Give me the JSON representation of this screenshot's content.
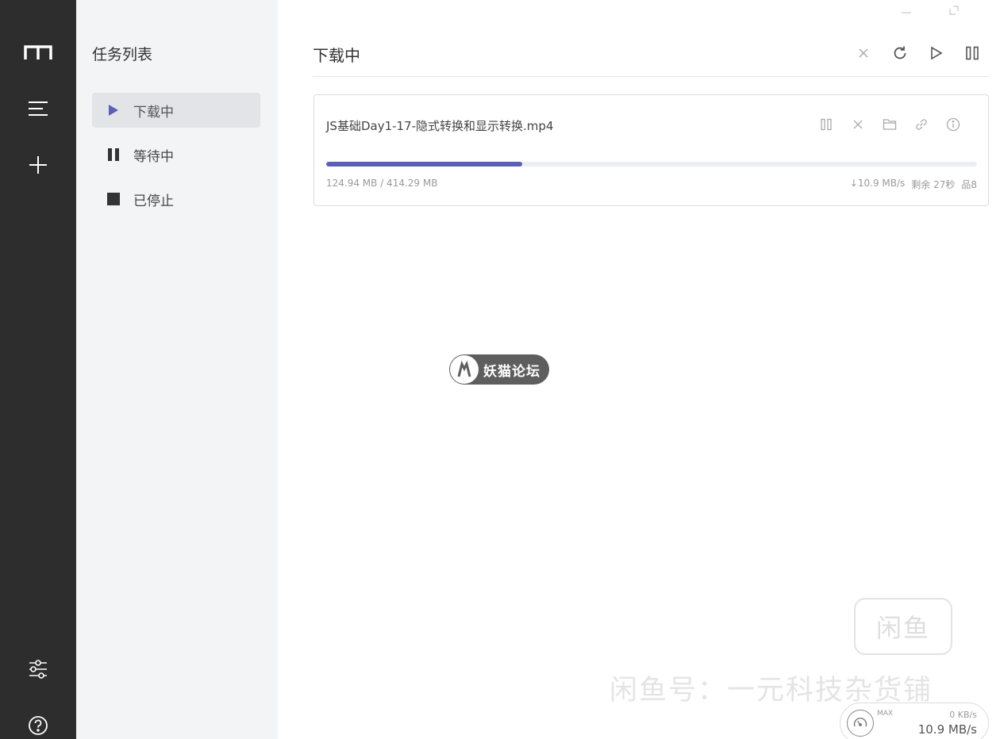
{
  "rail": {
    "logo_icon": "app-logo-icon",
    "items": [
      {
        "name": "task-list-icon"
      },
      {
        "name": "add-icon"
      }
    ],
    "bottom": [
      {
        "name": "settings-sliders-icon"
      },
      {
        "name": "help-icon"
      }
    ]
  },
  "tasklist": {
    "title": "任务列表",
    "items": [
      {
        "label": "下载中",
        "icon": "play-icon",
        "active": true
      },
      {
        "label": "等待中",
        "icon": "pause-icon",
        "active": false
      },
      {
        "label": "已停止",
        "icon": "stop-icon",
        "active": false
      }
    ]
  },
  "main": {
    "title": "下载中",
    "toolbar": [
      "close-icon",
      "refresh-icon",
      "play-icon",
      "pause-icon"
    ]
  },
  "task": {
    "name": "JS基础Day1-17-隐式转换和显示转换.mp4",
    "size": "124.94 MB / 414.29 MB",
    "progress": 0.3016,
    "speed": "↓10.9 MB/s",
    "remaining": "剩余 27秒",
    "connections": "品8",
    "actions": [
      "pause-icon",
      "delete-icon",
      "folder-icon",
      "link-icon",
      "info-icon"
    ]
  },
  "watermarks": {
    "badge": "妖猫论坛",
    "box": "闲鱼",
    "line": "闲鱼号：一元科技杂货铺"
  },
  "speed_widget": {
    "max_label": "MAX",
    "upload": "0 KB/s",
    "download": "10.9 MB/s"
  },
  "colors": {
    "accent": "#5b5fb8",
    "rail_bg": "#2d2d2d",
    "sidebar_bg": "#f3f4f6"
  }
}
